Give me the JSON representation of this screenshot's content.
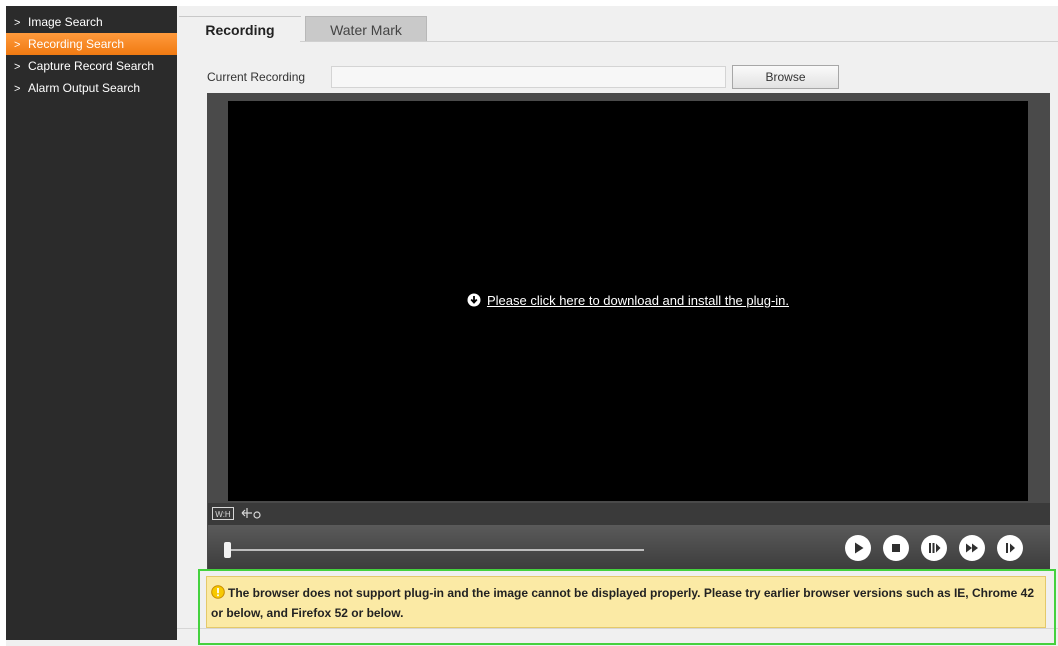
{
  "sidebar": {
    "items": [
      {
        "label": "Image Search",
        "active": false
      },
      {
        "label": "Recording Search",
        "active": true
      },
      {
        "label": "Capture Record Search",
        "active": false
      },
      {
        "label": "Alarm Output Search",
        "active": false
      }
    ]
  },
  "tabs": [
    {
      "label": "Recording",
      "active": true
    },
    {
      "label": "Water Mark",
      "active": false
    }
  ],
  "current_recording": {
    "label": "Current Recording",
    "value": "",
    "browse_label": "Browse"
  },
  "player": {
    "plugin_message": "Please click here to download and install the plug-in.",
    "toolstrip": {
      "wh_label": "W:H"
    },
    "progress": 0
  },
  "warning": {
    "text": "The browser does not support plug-in and the image cannot be displayed properly. Please try earlier browser versions such as IE, Chrome 42 or below, and Firefox 52 or below."
  },
  "colors": {
    "sidebar_bg": "#2b2b2b",
    "active_item": "#f58a1f",
    "warning_bg": "#fbeaa5",
    "highlight_border": "#45d13e"
  }
}
